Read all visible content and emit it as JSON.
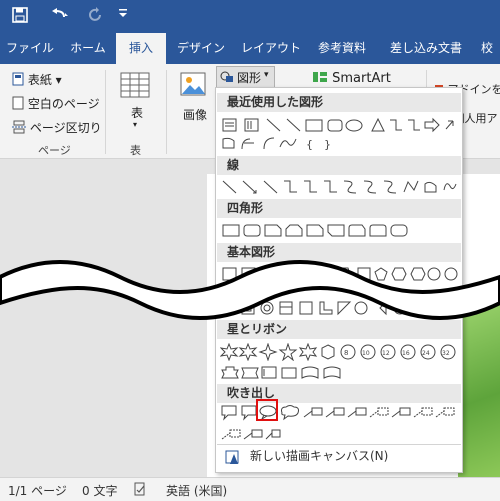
{
  "qat": {
    "save_icon": "floppy-disk-icon",
    "undo_icon": "undo-icon",
    "redo_icon": "redo-icon",
    "customize_icon": "customize-icon"
  },
  "tabs": [
    {
      "label": "ファイル"
    },
    {
      "label": "ホーム"
    },
    {
      "label": "挿入",
      "active": true
    },
    {
      "label": "デザイン"
    },
    {
      "label": "レイアウト"
    },
    {
      "label": "参考資料"
    },
    {
      "label": "差し込み文書"
    },
    {
      "label": "校"
    }
  ],
  "ribbon": {
    "cover": "表紙 ▾",
    "blank": "空白のページ",
    "pagebreak": "ページ区切り",
    "pages_group": "ページ",
    "table": "表",
    "table_group": "表",
    "image": "画像",
    "shapes": "図形",
    "smartart": "SmartArt",
    "addins": "アドインを",
    "personal": "個人用ア"
  },
  "menu": {
    "categories": [
      "最近使用した図形",
      "線",
      "四角形",
      "基本図形",
      "星とリボン",
      "吹き出し"
    ],
    "new_canvas": "新しい描画キャンバス(N)"
  },
  "status": {
    "page": "1/1 ページ",
    "words": "0 文字",
    "language": "英語 (米国)"
  },
  "colors": {
    "accent": "#2b579a",
    "highlight": "#e01010"
  }
}
